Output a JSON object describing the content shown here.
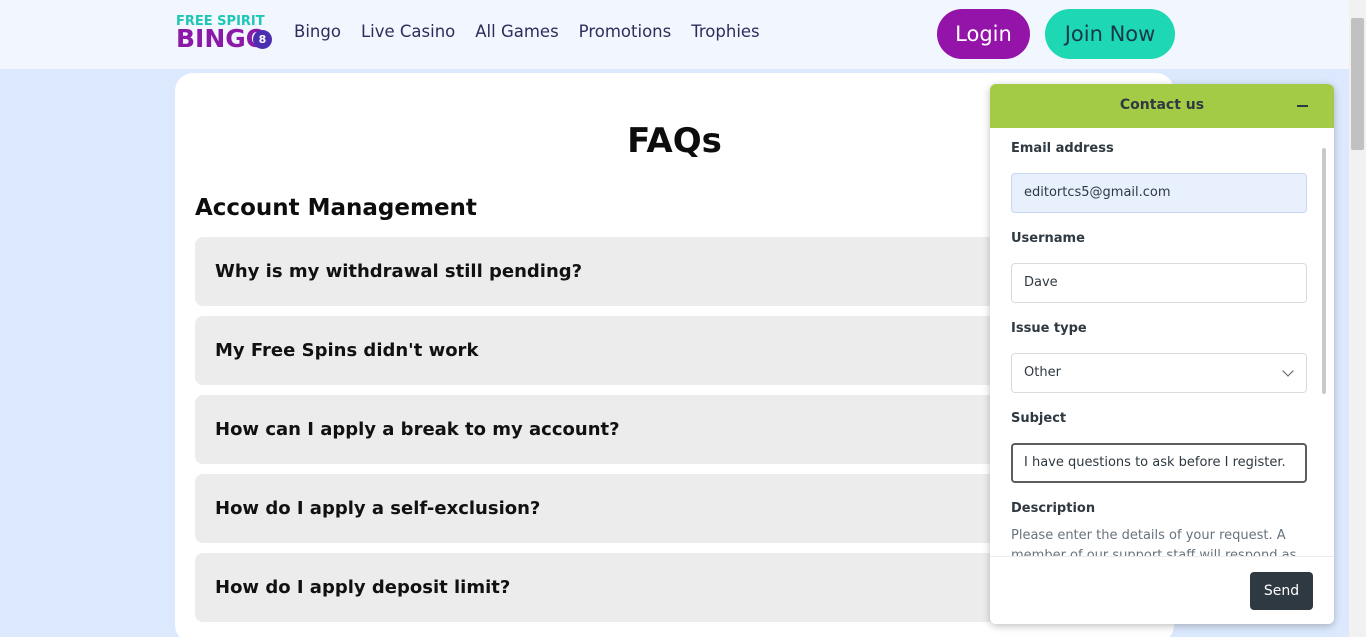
{
  "logo": {
    "top": "FREE SPIRIT",
    "bottom": "BINGO",
    "ball": "8"
  },
  "nav": [
    "Bingo",
    "Live Casino",
    "All Games",
    "Promotions",
    "Trophies"
  ],
  "auth": {
    "login": "Login",
    "join": "Join Now"
  },
  "page": {
    "title": "FAQs",
    "section": "Account Management"
  },
  "faqs": [
    "Why is my withdrawal still pending?",
    "My Free Spins didn't work",
    "How can I apply a break to my account?",
    "How do I apply a self-exclusion?",
    "How do I apply deposit limit?"
  ],
  "widget": {
    "title": "Contact us",
    "email_label": "Email address",
    "email_value": "editortcs5@gmail.com",
    "username_label": "Username",
    "username_value": "Dave",
    "issue_label": "Issue type",
    "issue_value": "Other",
    "subject_label": "Subject",
    "subject_value": "I have questions to ask before I register.",
    "description_label": "Description",
    "description_placeholder": "Please enter the details of your request. A member of our support staff will respond as soon as possible.",
    "send": "Send"
  },
  "colors": {
    "accent_purple": "#9413a8",
    "accent_teal": "#1ed7b3",
    "widget_header": "#a4cb45"
  },
  "icons": [
    "minimize-icon",
    "chevron-down-icon"
  ]
}
